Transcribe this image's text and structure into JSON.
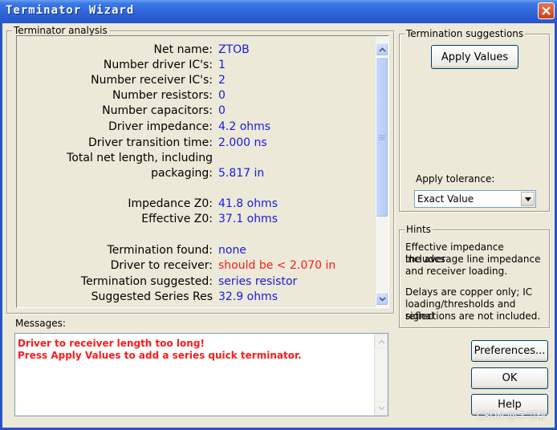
{
  "window": {
    "title": "Terminator Wizard"
  },
  "analysis": {
    "legend": "Terminator analysis",
    "rows": [
      {
        "label": "Net name:",
        "value": "ZTOB"
      },
      {
        "label": "Number driver IC's:",
        "value": "1"
      },
      {
        "label": "Number receiver IC's:",
        "value": "2"
      },
      {
        "label": "Number resistors:",
        "value": "0"
      },
      {
        "label": "Number capacitors:",
        "value": "0"
      },
      {
        "label": "Driver impedance:",
        "value": "4.2 ohms"
      },
      {
        "label": "Driver transition time:",
        "value": "2.000 ns"
      },
      {
        "label": "Total net length, including",
        "value": ""
      },
      {
        "label": "packaging:",
        "value": "5.817 in"
      },
      {
        "label": "Impedance Z0:",
        "value": "41.8 ohms"
      },
      {
        "label": "Effective Z0:",
        "value": "37.1 ohms"
      },
      {
        "label": "Termination found:",
        "value": "none"
      },
      {
        "label": "Driver to receiver:",
        "value": "should be < 2.070 in"
      },
      {
        "label": "Termination suggested:",
        "value": "series resistor"
      },
      {
        "label": "Suggested Series Res",
        "value": "32.9 ohms"
      }
    ]
  },
  "suggestions": {
    "legend": "Termination suggestions",
    "apply_values": "Apply Values",
    "tolerance_label": "Apply tolerance:",
    "tolerance_value": "Exact Value"
  },
  "hints": {
    "legend": "Hints",
    "p1": [
      "Effective impedance includes",
      "the average line impedance",
      "and receiver loading."
    ],
    "p2": [
      "Delays are copper only; IC",
      "loading/thresholds and signal",
      "reflections are not  included."
    ]
  },
  "messages": {
    "label": "Messages:",
    "lines": [
      "Driver to receiver length too long!",
      "Press Apply Values to add a series quick terminator."
    ]
  },
  "buttons": {
    "preferences": "Preferences...",
    "ok": "OK",
    "help": "Help"
  },
  "watermark": "CSDN @学习帮",
  "colors": {
    "value_blue": "#1a1adc",
    "warning_red": "#ff1a1a",
    "titlebar": "#2f64d8"
  }
}
